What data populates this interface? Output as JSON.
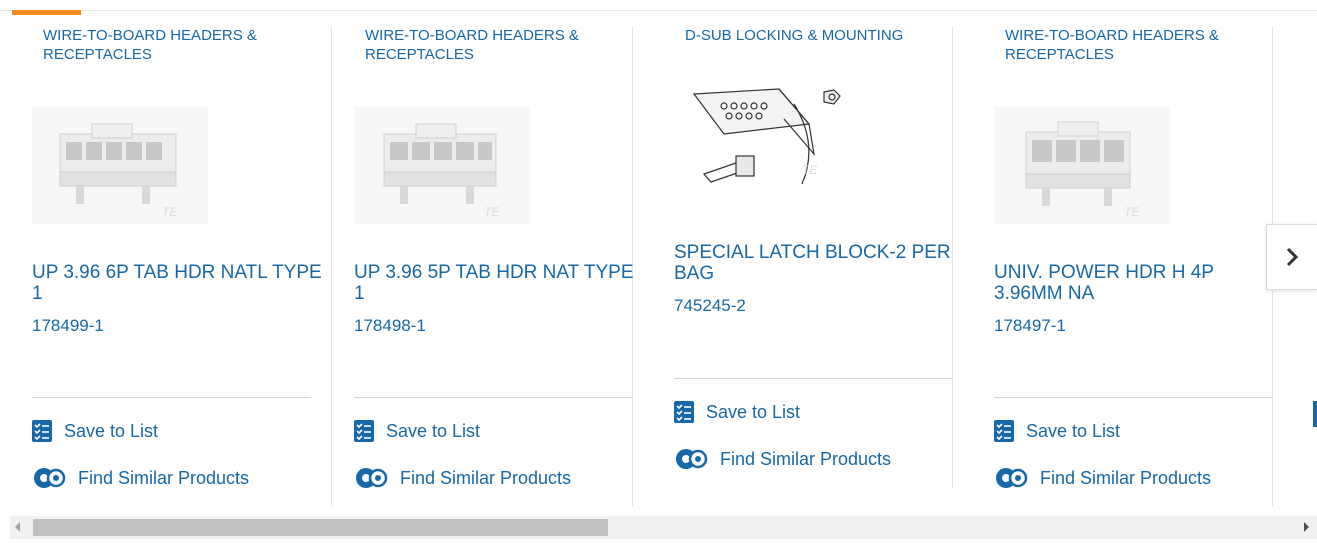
{
  "cards": [
    {
      "category": "WIRE-TO-BOARD HEADERS & RECEPTACLES",
      "title": "UP 3.96 6P TAB HDR NATL TYPE 1",
      "part_number": "178499-1",
      "save_label": "Save to List",
      "similar_label": "Find Similar Products",
      "image_icon": "connector-header-icon"
    },
    {
      "category": "WIRE-TO-BOARD HEADERS & RECEPTACLES",
      "title": "UP 3.96 5P TAB HDR NAT TYPE 1",
      "part_number": "178498-1",
      "save_label": "Save to List",
      "similar_label": "Find Similar Products",
      "image_icon": "connector-header-icon"
    },
    {
      "category": "D-SUB LOCKING & MOUNTING",
      "title": "SPECIAL LATCH BLOCK-2 PER BAG",
      "part_number": "745245-2",
      "save_label": "Save to List",
      "similar_label": "Find Similar Products",
      "image_icon": "latch-block-drawing-icon"
    },
    {
      "category": "WIRE-TO-BOARD HEADERS & RECEPTACLES",
      "title": "UNIV. POWER HDR H 4P 3.96MM NA",
      "part_number": "178497-1",
      "save_label": "Save to List",
      "similar_label": "Find Similar Products",
      "image_icon": "connector-header-icon"
    }
  ],
  "watermark": "TE",
  "carousel": {
    "next_icon": "chevron-right-icon"
  },
  "colors": {
    "link": "#1768a8",
    "accent": "#f28c1c",
    "divider": "#d8d8d8"
  }
}
